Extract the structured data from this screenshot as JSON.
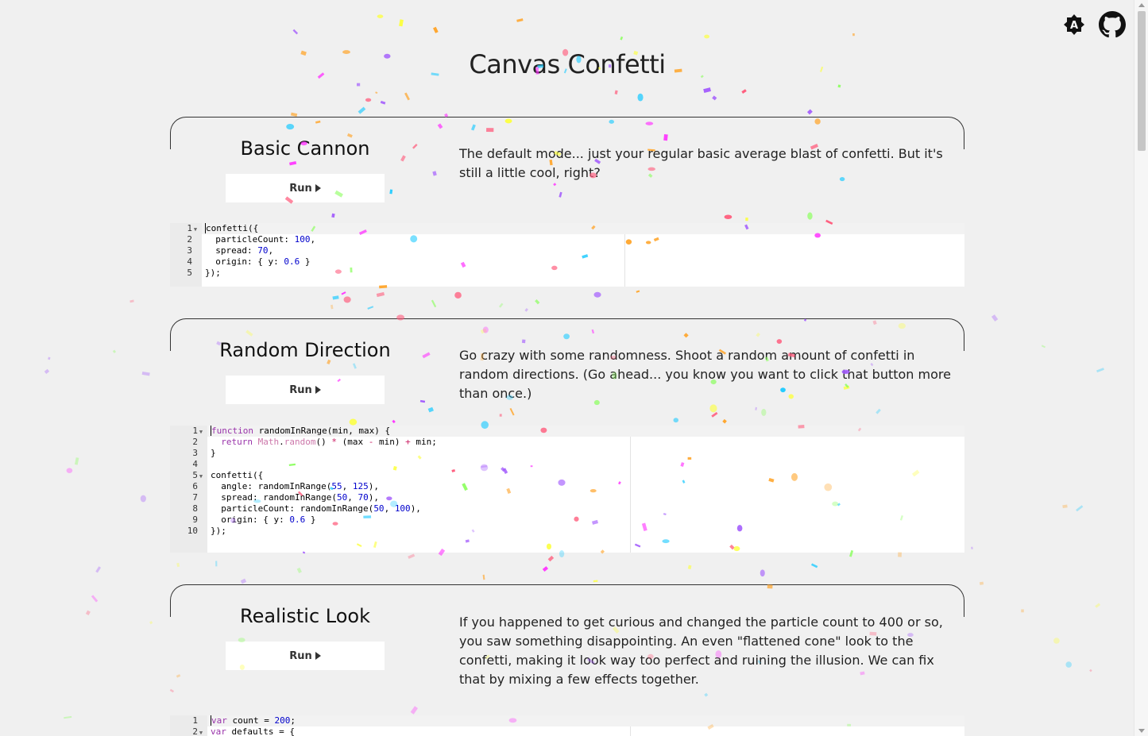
{
  "page": {
    "title": "Canvas Confetti"
  },
  "header_icons": {
    "theme": "theme-toggle-icon",
    "github": "github-icon"
  },
  "sections": [
    {
      "title": "Basic Cannon",
      "run_label": "Run",
      "description": "The default mode... just your regular basic average blast of confetti. But it's still a little cool, right?",
      "code_lines": [
        "confetti({",
        "  particleCount: 100,",
        "  spread: 70,",
        "  origin: { y: 0.6 }",
        "});"
      ]
    },
    {
      "title": "Random Direction",
      "run_label": "Run",
      "description": "Go crazy with some randomness. Shoot a random amount of confetti in random directions. (Go ahead... you know you want to click that button more than once.)",
      "code_lines": [
        "function randomInRange(min, max) {",
        "  return Math.random() * (max - min) + min;",
        "}",
        "",
        "confetti({",
        "  angle: randomInRange(55, 125),",
        "  spread: randomInRange(50, 70),",
        "  particleCount: randomInRange(50, 100),",
        "  origin: { y: 0.6 }",
        "});"
      ]
    },
    {
      "title": "Realistic Look",
      "run_label": "Run",
      "description": "If you happened to get curious and changed the particle count to 400 or so, you saw something disappointing. An even \"flattened cone\" look to the confetti, making it look way too perfect and ruining the illusion. We can fix that by mixing a few effects together.",
      "code_lines": [
        "var count = 200;",
        "var defaults = {"
      ]
    }
  ],
  "confetti_colors": [
    "#26ccff",
    "#a25afd",
    "#ff5e7e",
    "#88ff5a",
    "#fcff42",
    "#ffa62d",
    "#ff36ff"
  ]
}
